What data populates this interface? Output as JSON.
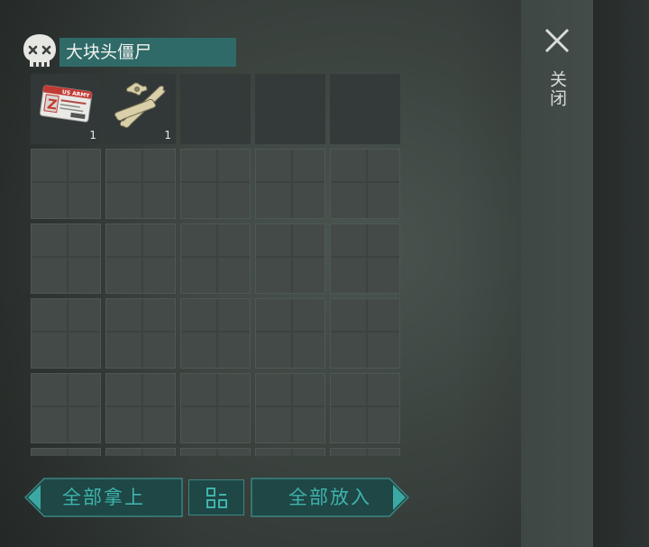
{
  "container": {
    "title": "大块头僵尸",
    "icon": "skull-icon"
  },
  "close": {
    "label": "关闭",
    "icon": "close-icon"
  },
  "inventory": {
    "columns": 5,
    "items": [
      {
        "name": "us-army-id-card",
        "icon": "id-card-icon",
        "count": "1",
        "card_text": "US ARMY",
        "card_letter": "Z"
      },
      {
        "name": "bones",
        "icon": "bones-icon",
        "count": "1"
      }
    ]
  },
  "actions": {
    "take_all": "全部拿上",
    "sort_icon": "sort-grid-icon",
    "put_all": "全部放入"
  },
  "colors": {
    "accent": "#3fb3ad",
    "title_bar": "#2f6a68",
    "button_fill": "#1e4745"
  }
}
